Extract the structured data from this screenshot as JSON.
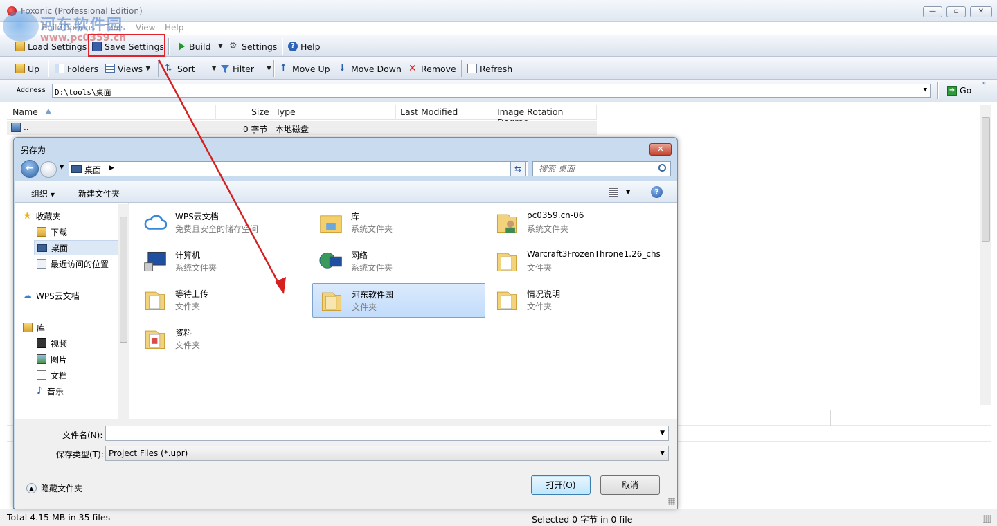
{
  "window": {
    "title": "Foxonic (Professional Edition)"
  },
  "menu": [
    "Build",
    "Options",
    "Tools",
    "View",
    "Help"
  ],
  "toolbar1": {
    "load_settings": "Load Settings",
    "save_settings": "Save Settings",
    "build": "Build",
    "settings": "Settings",
    "help": "Help"
  },
  "toolbar2": {
    "up": "Up",
    "folders": "Folders",
    "views": "Views",
    "sort": "Sort",
    "filter": "Filter",
    "move_up": "Move Up",
    "move_down": "Move Down",
    "remove": "Remove",
    "refresh": "Refresh"
  },
  "address": {
    "label": "Address",
    "value": "D:\\tools\\桌面",
    "go": "Go"
  },
  "file_list": {
    "columns": [
      "Name",
      "Size",
      "Type",
      "Last Modified",
      "Image Rotation Degree"
    ],
    "rows": [
      {
        "name": "..",
        "size": "0 字节",
        "type": "本地磁盘"
      }
    ]
  },
  "status": {
    "left": "Total 4.15 MB in 35 files",
    "right": "Selected 0 字节 in 0 file"
  },
  "watermark": {
    "text1": "河东软件园",
    "text2": "www.pc0359.cn"
  },
  "dialog": {
    "title": "另存为",
    "path": "桌面",
    "search_placeholder": "搜索 桌面",
    "organize": "组织",
    "new_folder": "新建文件夹",
    "nav": {
      "favorites": "收藏夹",
      "downloads": "下载",
      "desktop": "桌面",
      "recent": "最近访问的位置",
      "wps": "WPS云文档",
      "libraries": "库",
      "videos": "视频",
      "pictures": "图片",
      "documents": "文档",
      "music": "音乐"
    },
    "items": [
      {
        "name": "WPS云文档",
        "desc": "免费且安全的储存空间",
        "icon": "cloud-icon"
      },
      {
        "name": "库",
        "desc": "系统文件夹",
        "icon": "library-folder-icon"
      },
      {
        "name": "pc0359.cn-06",
        "desc": "系统文件夹",
        "icon": "user-folder-icon"
      },
      {
        "name": "计算机",
        "desc": "系统文件夹",
        "icon": "computer-icon"
      },
      {
        "name": "网络",
        "desc": "系统文件夹",
        "icon": "network-icon"
      },
      {
        "name": "Warcraft3FrozenThrone1.26_chs",
        "desc": "文件夹",
        "icon": "folder-icon"
      },
      {
        "name": "等待上传",
        "desc": "文件夹",
        "icon": "folder-icon"
      },
      {
        "name": "河东软件园",
        "desc": "文件夹",
        "icon": "folder-icon"
      },
      {
        "name": "情况说明",
        "desc": "文件夹",
        "icon": "folder-icon"
      },
      {
        "name": "资料",
        "desc": "文件夹",
        "icon": "folder-icon"
      }
    ],
    "filename_label": "文件名(N):",
    "filename_value": "",
    "filetype_label": "保存类型(T):",
    "filetype_value": "Project Files (*.upr)",
    "open": "打开(O)",
    "cancel": "取消",
    "hide_folders": "隐藏文件夹"
  },
  "colors": {
    "highlight": "#e3232b",
    "arrow": "#d42020",
    "selection": "#c1dcfb"
  }
}
